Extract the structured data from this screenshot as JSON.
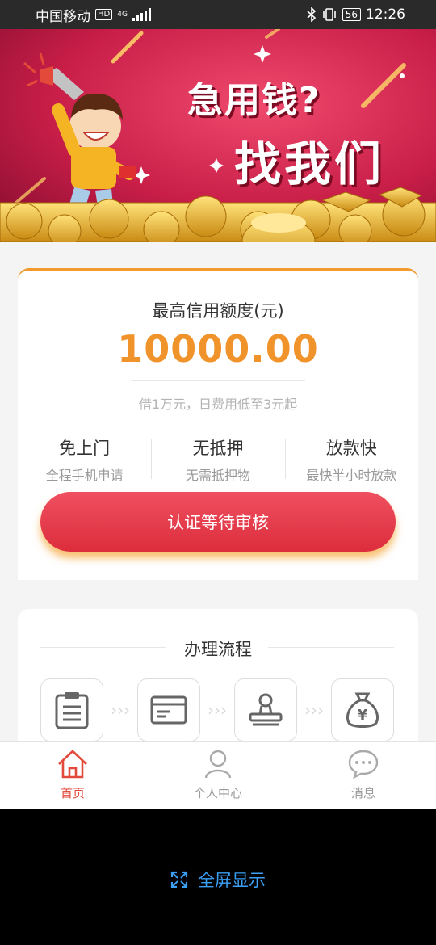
{
  "status_bar": {
    "carrier": "中国移动",
    "hd": "HD",
    "network": "4G",
    "battery": "56",
    "time": "12:26"
  },
  "banner": {
    "line1": "急用钱?",
    "line2": "找我们"
  },
  "credit_card": {
    "limit_label": "最高信用额度(元)",
    "limit_amount": "10000.00",
    "sub_text": "借1万元，日费用低至3元起",
    "features": [
      {
        "title": "免上门",
        "desc": "全程手机申请"
      },
      {
        "title": "无抵押",
        "desc": "无需抵押物"
      },
      {
        "title": "放款快",
        "desc": "最快半小时放款"
      }
    ],
    "cta_label": "认证等待审核"
  },
  "process": {
    "title": "办理流程",
    "steps": [
      "clipboard-icon",
      "card-icon",
      "stamp-icon",
      "money-bag-icon"
    ]
  },
  "tabbar": {
    "items": [
      {
        "label": "首页",
        "icon": "home-icon",
        "active": true
      },
      {
        "label": "个人中心",
        "icon": "person-icon",
        "active": false
      },
      {
        "label": "消息",
        "icon": "chat-icon",
        "active": false
      }
    ]
  },
  "footer": {
    "fullscreen_label": "全屏显示"
  },
  "colors": {
    "accent_orange": "#f0932a",
    "cta_red": "#e23a48",
    "tab_active": "#e24a3b",
    "link_blue": "#3a9ff5"
  }
}
